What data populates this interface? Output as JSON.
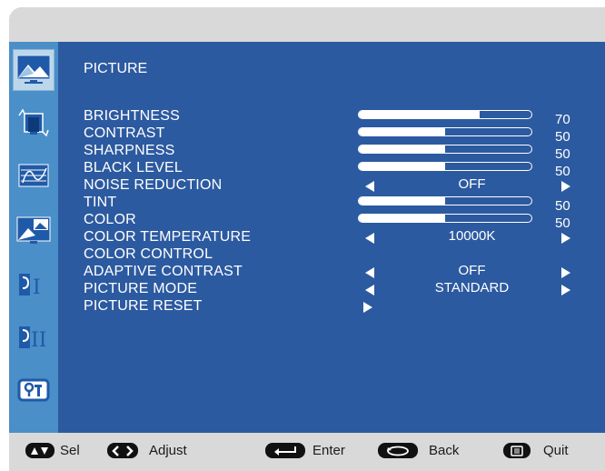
{
  "sidebar": {
    "items": [
      {
        "name": "picture",
        "icon": "picture-landscape-icon",
        "selected": true
      },
      {
        "name": "screen",
        "icon": "screen-adjust-icon",
        "selected": false
      },
      {
        "name": "audio",
        "icon": "audio-icon",
        "selected": false
      },
      {
        "name": "pip",
        "icon": "pip-icon",
        "selected": false
      },
      {
        "name": "setup1",
        "icon": "setup-one-icon",
        "selected": false
      },
      {
        "name": "setup2",
        "icon": "setup-two-icon",
        "selected": false
      },
      {
        "name": "information",
        "icon": "information-icon",
        "selected": false
      }
    ]
  },
  "menu": {
    "title": "PICTURE",
    "items": [
      {
        "label": "BRIGHTNESS",
        "type": "slider",
        "value": "70",
        "level": 70
      },
      {
        "label": "CONTRAST",
        "type": "slider",
        "value": "50",
        "level": 50
      },
      {
        "label": "SHARPNESS",
        "type": "slider",
        "value": "50",
        "level": 50
      },
      {
        "label": "BLACK LEVEL",
        "type": "slider",
        "value": "50",
        "level": 50
      },
      {
        "label": "NOISE REDUCTION",
        "type": "option",
        "value": "OFF"
      },
      {
        "label": "TINT",
        "type": "slider",
        "value": "50",
        "level": 50
      },
      {
        "label": "COLOR",
        "type": "slider",
        "value": "50",
        "level": 50
      },
      {
        "label": "COLOR TEMPERATURE",
        "type": "option",
        "value": "10000K"
      },
      {
        "label": "COLOR CONTROL",
        "type": "none"
      },
      {
        "label": "ADAPTIVE CONTRAST",
        "type": "option",
        "value": "OFF"
      },
      {
        "label": "PICTURE MODE",
        "type": "option",
        "value": "STANDARD"
      },
      {
        "label": "PICTURE RESET",
        "type": "enter"
      }
    ]
  },
  "footer": {
    "sel_label": "Sel",
    "adjust_label": "Adjust",
    "enter_label": "Enter",
    "back_label": "Back",
    "quit_label": "Quit"
  },
  "colors": {
    "main_bg": "#2c5aa0",
    "sidebar_bg": "#4a8fc8",
    "frame_bg": "#d9d9d9",
    "text": "#ffffff"
  }
}
